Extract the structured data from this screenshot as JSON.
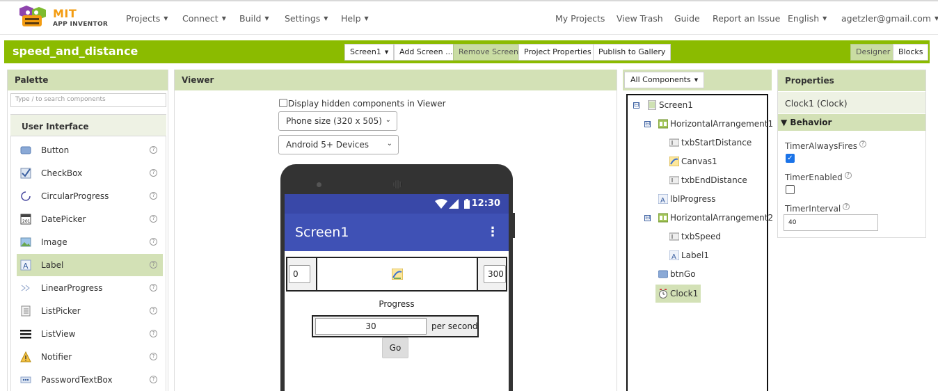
{
  "app": {
    "logo_text": "MIT",
    "logo_subtext": "APP INVENTOR"
  },
  "topnav": {
    "left": [
      "Projects",
      "Connect",
      "Build",
      "Settings",
      "Help"
    ],
    "my_projects": "My Projects",
    "view_trash": "View Trash",
    "guide": "Guide",
    "report_issue": "Report an Issue",
    "language": "English",
    "account": "agetzler@gmail.com"
  },
  "project_bar": {
    "name": "speed_and_distance",
    "screen_select": "Screen1",
    "add_screen": "Add Screen ...",
    "remove_screen": "Remove Screen",
    "project_properties": "Project Properties",
    "publish": "Publish to Gallery",
    "designer": "Designer",
    "blocks": "Blocks"
  },
  "palette": {
    "title": "Palette",
    "search_placeholder": "Type / to search components",
    "category": "User Interface",
    "items": [
      {
        "label": "Button",
        "icon": "button-icon"
      },
      {
        "label": "CheckBox",
        "icon": "checkbox-icon"
      },
      {
        "label": "CircularProgress",
        "icon": "circular-progress-icon"
      },
      {
        "label": "DatePicker",
        "icon": "datepicker-icon"
      },
      {
        "label": "Image",
        "icon": "image-icon"
      },
      {
        "label": "Label",
        "icon": "label-icon",
        "selected": true
      },
      {
        "label": "LinearProgress",
        "icon": "linear-progress-icon"
      },
      {
        "label": "ListPicker",
        "icon": "listpicker-icon"
      },
      {
        "label": "ListView",
        "icon": "listview-icon"
      },
      {
        "label": "Notifier",
        "icon": "notifier-icon"
      },
      {
        "label": "PasswordTextBox",
        "icon": "password-icon"
      }
    ]
  },
  "viewer": {
    "title": "Viewer",
    "display_hidden": "Display hidden components in Viewer",
    "phone_size": "Phone size (320 x 505)",
    "android": "Android 5+ Devices",
    "phone": {
      "time": "12:30",
      "screen_title": "Screen1",
      "start_distance": "0",
      "end_distance": "300",
      "progress_label": "Progress",
      "speed_value": "30",
      "per_second": "per second",
      "go_label": "Go"
    }
  },
  "components": {
    "dropdown": "All Components",
    "tree": [
      {
        "label": "Screen1",
        "icon": "screen-icon",
        "level": 0,
        "toggle": "⊟"
      },
      {
        "label": "HorizontalArrangement1",
        "icon": "arrangement-icon",
        "level": 1,
        "toggle": "⊟"
      },
      {
        "label": "txbStartDistance",
        "icon": "textbox-icon",
        "level": 2
      },
      {
        "label": "Canvas1",
        "icon": "canvas-icon",
        "level": 2
      },
      {
        "label": "txbEndDistance",
        "icon": "textbox-icon",
        "level": 2
      },
      {
        "label": "lblProgress",
        "icon": "label-icon",
        "level": 1
      },
      {
        "label": "HorizontalArrangement2",
        "icon": "arrangement-icon",
        "level": 1,
        "toggle": "⊟"
      },
      {
        "label": "txbSpeed",
        "icon": "textbox-icon",
        "level": 2
      },
      {
        "label": "Label1",
        "icon": "label-icon",
        "level": 2
      },
      {
        "label": "btnGo",
        "icon": "button-icon",
        "level": 1
      },
      {
        "label": "Clock1",
        "icon": "clock-icon",
        "level": 1,
        "selected": true
      }
    ]
  },
  "properties": {
    "title": "Properties",
    "component": "Clock1 (Clock)",
    "section": "Behavior",
    "timer_always_fires_label": "TimerAlwaysFires",
    "timer_always_fires": true,
    "timer_enabled_label": "TimerEnabled",
    "timer_enabled": false,
    "timer_interval_label": "TimerInterval",
    "timer_interval": "40"
  },
  "colors": {
    "accent_green": "#8bbb00",
    "panel_head": "#d3e1b6",
    "phone_bar": "#3f51b5"
  }
}
